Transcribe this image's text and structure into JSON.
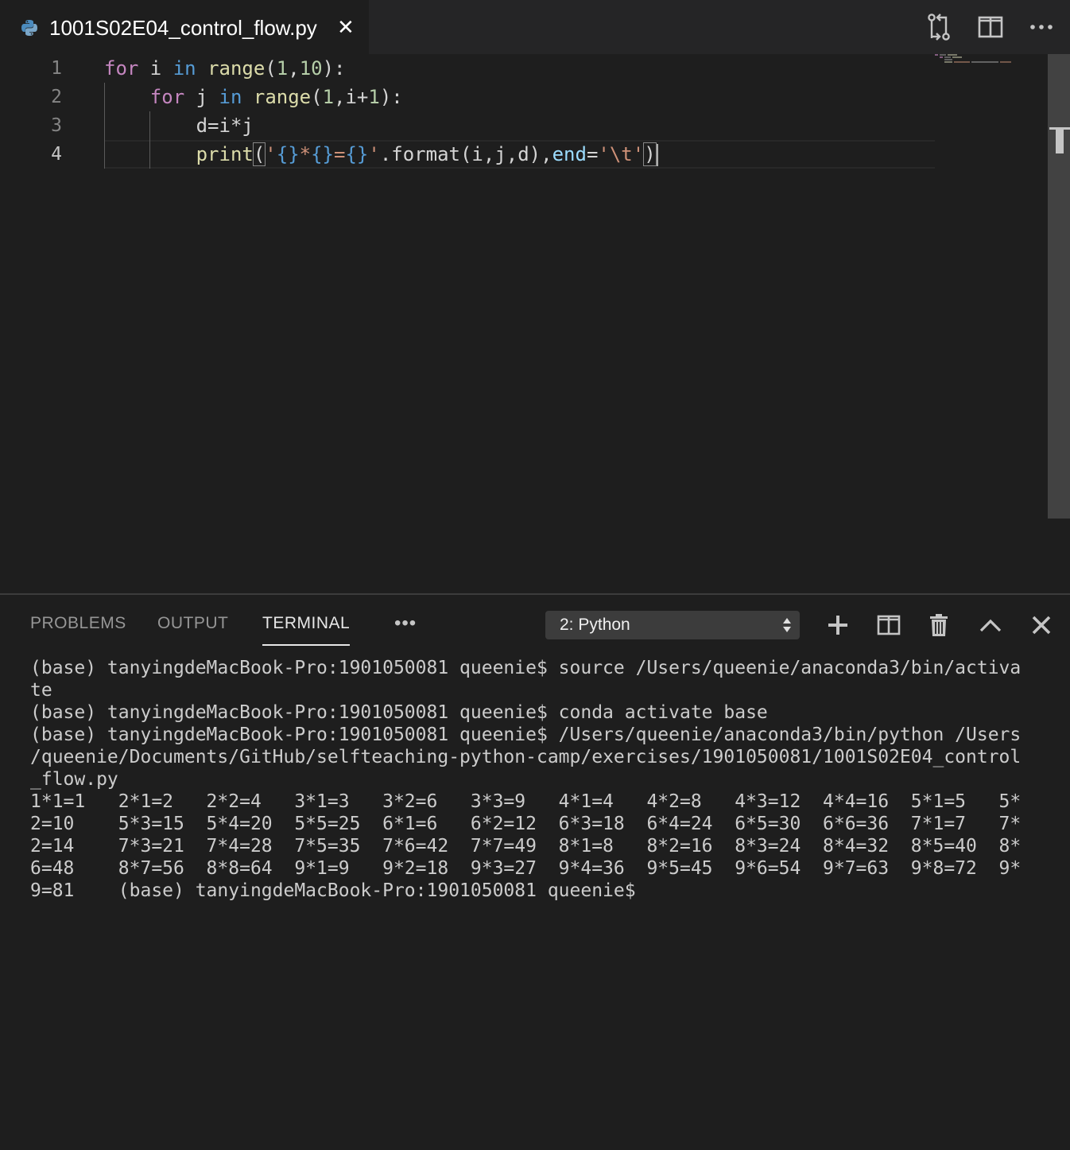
{
  "tab": {
    "filename": "1001S02E04_control_flow.py",
    "close_glyph": "✕"
  },
  "editor": {
    "line_numbers": [
      "1",
      "2",
      "3",
      "4"
    ],
    "code": {
      "l1": {
        "kw1": "for",
        "v1": " i ",
        "kw2": "in",
        "sp": " ",
        "fn": "range",
        "p1": "(",
        "n1": "1",
        "c": ",",
        "n2": "10",
        "p2": "):"
      },
      "l2": {
        "indent": "    ",
        "kw1": "for",
        "v1": " j ",
        "kw2": "in",
        "sp": " ",
        "fn": "range",
        "p1": "(",
        "n1": "1",
        "c": ",i+",
        "n2": "1",
        "p2": "):"
      },
      "l3": {
        "indent": "        ",
        "text": "d=i*j"
      },
      "l4": {
        "indent": "        ",
        "fn": "print",
        "p1": "(",
        "q1": "'",
        "ph1": "{}",
        "star": "*",
        "ph2": "{}",
        "eq": "=",
        "ph3": "{}",
        "q2": "'",
        "mid": ".format(i,j,d),",
        "param": "end",
        "eq2": "=",
        "str2": "'\\t'",
        "p2": ")"
      }
    }
  },
  "panel": {
    "tabs": [
      "PROBLEMS",
      "OUTPUT",
      "TERMINAL"
    ],
    "active_tab": "TERMINAL",
    "more": "•••",
    "terminal_select": "2: Python"
  },
  "terminal": {
    "lines": [
      "(base) tanyingdeMacBook-Pro:1901050081 queenie$ source /Users/queenie/anaconda3/bin/activa",
      "te",
      "(base) tanyingdeMacBook-Pro:1901050081 queenie$ conda activate base",
      "(base) tanyingdeMacBook-Pro:1901050081 queenie$ /Users/queenie/anaconda3/bin/python /Users",
      "/queenie/Documents/GitHub/selfteaching-python-camp/exercises/1901050081/1001S02E04_control",
      "_flow.py",
      "1*1=1   2*1=2   2*2=4   3*1=3   3*2=6   3*3=9   4*1=4   4*2=8   4*3=12  4*4=16  5*1=5   5*",
      "2=10    5*3=15  5*4=20  5*5=25  6*1=6   6*2=12  6*3=18  6*4=24  6*5=30  6*6=36  7*1=7   7*",
      "2=14    7*3=21  7*4=28  7*5=35  7*6=42  7*7=49  8*1=8   8*2=16  8*3=24  8*4=32  8*5=40  8*",
      "6=48    8*7=56  8*8=64  9*1=9   9*2=18  9*3=27  9*4=36  9*5=45  9*6=54  9*7=63  9*8=72  9*",
      "9=81    (base) tanyingdeMacBook-Pro:1901050081 queenie$"
    ]
  },
  "colors": {
    "editor_bg": "#1e1e1e",
    "tabbar_bg": "#252526",
    "keyword": "#c586c0",
    "builtin_kw": "#569cd6",
    "function": "#dcdcaa",
    "number": "#b5cea8",
    "string": "#ce9178",
    "parameter": "#9cdcfe"
  },
  "icons": {
    "file_type": "python-icon",
    "toolbar": [
      "open-changes-icon",
      "split-editor-icon",
      "more-actions-icon"
    ],
    "panel": [
      "add-terminal-icon",
      "split-terminal-icon",
      "trash-icon",
      "maximize-panel-icon",
      "close-panel-icon"
    ]
  }
}
